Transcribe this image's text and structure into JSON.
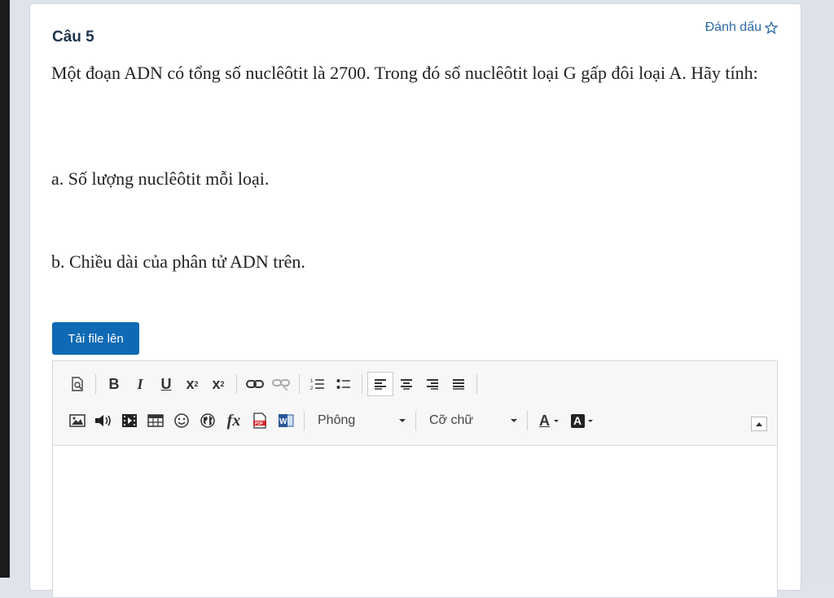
{
  "question": {
    "title": "Câu 5",
    "flag_label": "Đánh dấu",
    "text": "Một đoạn ADN có tổng số nuclêôtit là 2700. Trong đó số nuclêôtit loại G gấp đôi loại A. Hãy tính:",
    "part_a": "a. Số lượng nuclêôtit mỗi loại.",
    "part_b": "b. Chiều dài của phân tử ADN trên."
  },
  "upload_button": "Tải file lên",
  "editor": {
    "font_combo": "Phông",
    "size_combo": "Cỡ chữ",
    "toolbar_row1": [
      "preview-icon",
      "bold-icon",
      "italic-icon",
      "underline-icon",
      "subscript-icon",
      "superscript-icon",
      "link-icon",
      "unlink-icon",
      "numbered-list-icon",
      "bulleted-list-icon",
      "align-left-icon",
      "align-center-icon",
      "align-right-icon",
      "justify-icon"
    ],
    "toolbar_row2": [
      "image-icon",
      "audio-icon",
      "video-icon",
      "table-icon",
      "smiley-icon",
      "globe-icon",
      "formula-icon",
      "pdf-icon",
      "word-icon",
      "text-color-icon",
      "background-color-icon"
    ]
  },
  "colors": {
    "accent": "#0f69b4",
    "title": "#1f3550",
    "link": "#2d6aa5"
  }
}
